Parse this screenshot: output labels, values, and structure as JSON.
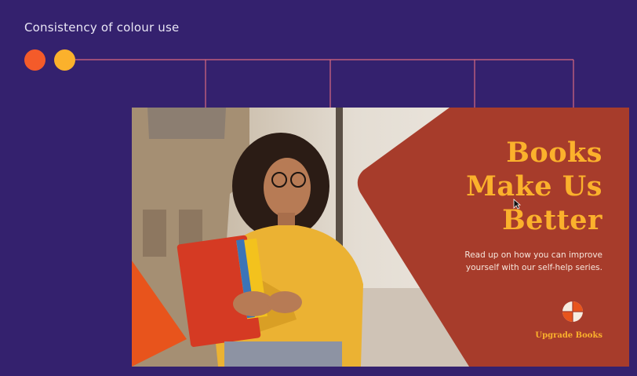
{
  "page": {
    "heading": "Consistency of colour use"
  },
  "colors": {
    "background": "#34216e",
    "swatch_1": "#f45b2a",
    "swatch_2": "#fbb12c",
    "panel": "#a73c2b",
    "accent_triangle": "#e8541c",
    "guide_line": "#d96a7e"
  },
  "slide": {
    "title_lines": [
      "Books",
      "Make Us",
      "Better"
    ],
    "subtitle_lines": [
      "Read up on how you can improve",
      "yourself with our self-help series."
    ],
    "brand": "Upgrade Books",
    "logo_icon": "quartered-circle-logo-icon",
    "photo_icon": "woman-holding-books-photo"
  }
}
